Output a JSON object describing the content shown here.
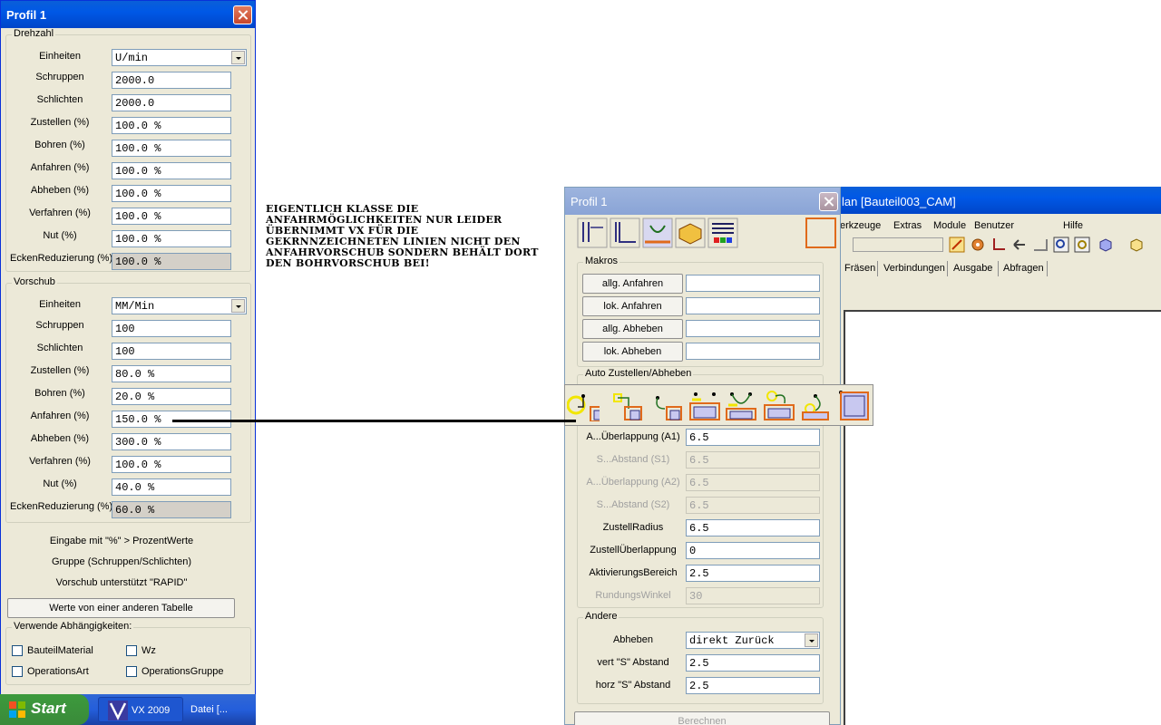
{
  "left_dialog": {
    "title": "Profil 1",
    "drehzahl": {
      "group_title": "Drehzahl",
      "rows": [
        {
          "label": "Einheiten",
          "value": "U/min"
        },
        {
          "label": "Schruppen",
          "value": "2000.0"
        },
        {
          "label": "Schlichten",
          "value": "2000.0"
        },
        {
          "label": "Zustellen (%)",
          "value": "100.0 %"
        },
        {
          "label": "Bohren (%)",
          "value": "100.0 %"
        },
        {
          "label": "Anfahren (%)",
          "value": "100.0 %"
        },
        {
          "label": "Abheben (%)",
          "value": "100.0 %"
        },
        {
          "label": "Verfahren (%)",
          "value": "100.0 %"
        },
        {
          "label": "Nut (%)",
          "value": "100.0 %"
        },
        {
          "label": "EckenReduzierung (%)",
          "value": "100.0 %"
        }
      ]
    },
    "vorschub": {
      "group_title": "Vorschub",
      "rows": [
        {
          "label": "Einheiten",
          "value": "MM/Min"
        },
        {
          "label": "Schruppen",
          "value": "100"
        },
        {
          "label": "Schlichten",
          "value": "100"
        },
        {
          "label": "Zustellen (%)",
          "value": "80.0 %"
        },
        {
          "label": "Bohren (%)",
          "value": "20.0 %"
        },
        {
          "label": "Anfahren (%)",
          "value": "150.0 %"
        },
        {
          "label": "Abheben (%)",
          "value": "300.0 %"
        },
        {
          "label": "Verfahren (%)",
          "value": "100.0 %"
        },
        {
          "label": "Nut (%)",
          "value": "40.0 %"
        },
        {
          "label": "EckenReduzierung (%)",
          "value": "60.0 %"
        }
      ]
    },
    "info_lines": [
      "Eingabe mit \"%\" > ProzentWerte",
      "Gruppe (Schruppen/Schlichten)",
      "Vorschub unterstützt \"RAPID\""
    ],
    "other_table_button": "Werte von einer anderen Tabelle",
    "dependencies": {
      "group_title": "Verwende Abhängigkeiten:",
      "items": [
        "BauteilMaterial",
        "Wz",
        "OperationsArt",
        "OperationsGruppe"
      ]
    }
  },
  "taskbar": {
    "start_label": "Start",
    "tasks": [
      "VX 2009",
      "Datei [..."
    ]
  },
  "annotation": "Eigentlich klasse die Anfahrmöglichkeiten nur leider übernimmt VX für die gekrnnzeichneten Linien nicht den Anfahrvorschub sondern behält dort den Bohrvorschub bei!",
  "cam_window": {
    "title": "lan [Bauteil003_CAM]",
    "menu": [
      "erkzeuge",
      "Extras",
      "Module",
      "Benutzer",
      "Hilfe"
    ],
    "tabs": [
      "Fräsen",
      "Verbindungen",
      "Ausgabe",
      "Abfragen"
    ]
  },
  "right_dialog": {
    "title": "Profil 1",
    "makros": {
      "group_title": "Makros",
      "buttons": [
        "allg. Anfahren",
        "lok. Anfahren",
        "allg. Abheben",
        "lok. Abheben"
      ]
    },
    "auto": {
      "group_title": "Auto Zustellen/Abheben",
      "rows": [
        {
          "label": "A...Überlappung (A1)",
          "value": "6.5",
          "enabled": true
        },
        {
          "label": "S...Abstand (S1)",
          "value": "6.5",
          "enabled": false
        },
        {
          "label": "A...Überlappung (A2)",
          "value": "6.5",
          "enabled": false
        },
        {
          "label": "S...Abstand (S2)",
          "value": "6.5",
          "enabled": false
        },
        {
          "label": "ZustellRadius",
          "value": "6.5",
          "enabled": true
        },
        {
          "label": "ZustellÜberlappung",
          "value": "0",
          "enabled": true
        },
        {
          "label": "AktivierungsBereich",
          "value": "2.5",
          "enabled": true
        },
        {
          "label": "RundungsWinkel",
          "value": "30",
          "enabled": false
        }
      ]
    },
    "andere": {
      "group_title": "Andere",
      "rows": [
        {
          "label": "Abheben",
          "value": "direkt Zurück"
        },
        {
          "label": "vert \"S\" Abstand",
          "value": "2.5"
        },
        {
          "label": "horz \"S\" Abstand",
          "value": "2.5"
        }
      ]
    },
    "calc_button": "Berechnen"
  },
  "colors": {
    "titlebar": "#0058e6",
    "dialog_bg": "#ece9d8",
    "icon_orange": "#e06a1b",
    "icon_yellow": "#f2e600",
    "icon_fill": "#c8c8f0"
  }
}
